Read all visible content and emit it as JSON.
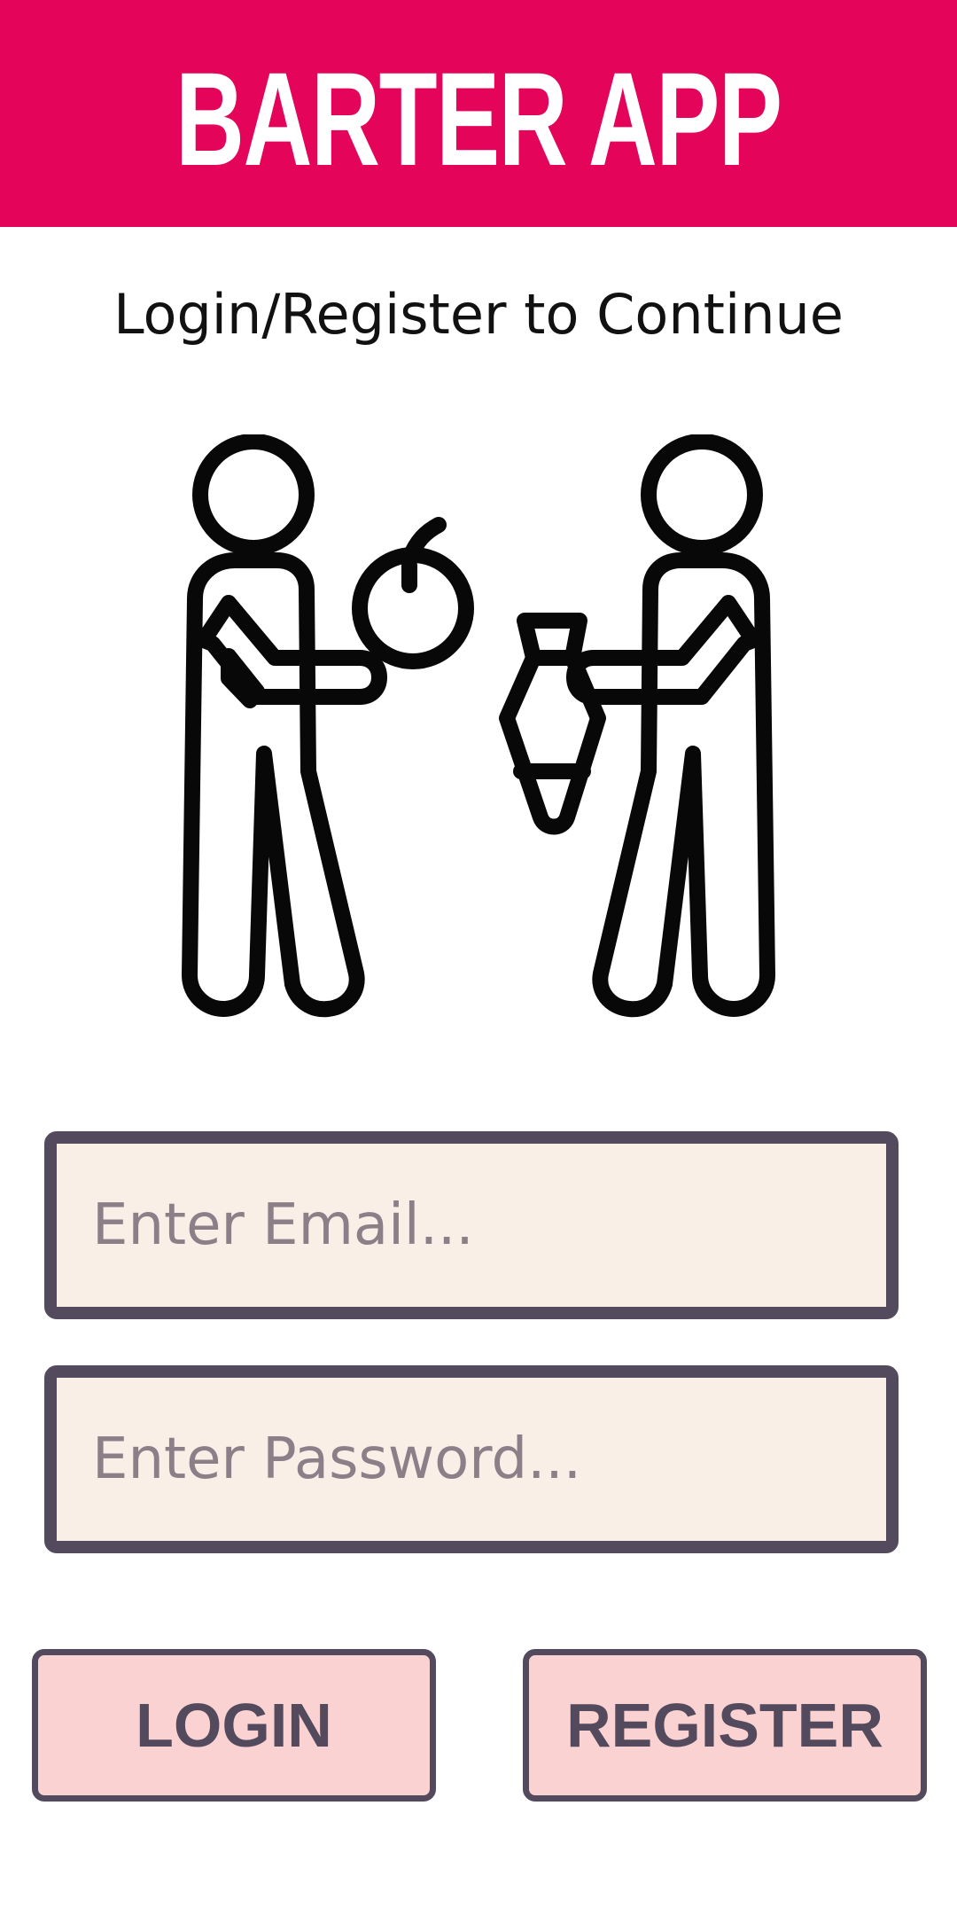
{
  "header": {
    "title": "BARTER APP",
    "background": "#e4055a"
  },
  "subtitle": "Login/Register to Continue",
  "illustration": {
    "icon": "barter-people-exchange-icon"
  },
  "form": {
    "email_placeholder": "Enter Email...",
    "email_value": "",
    "password_placeholder": "Enter Password...",
    "password_value": ""
  },
  "buttons": {
    "login_label": "LOGIN",
    "register_label": "REGISTER"
  },
  "colors": {
    "accent": "#e4055a",
    "border": "#544a5e",
    "input_bg": "#f9efe7",
    "button_bg": "#fad2d2"
  }
}
